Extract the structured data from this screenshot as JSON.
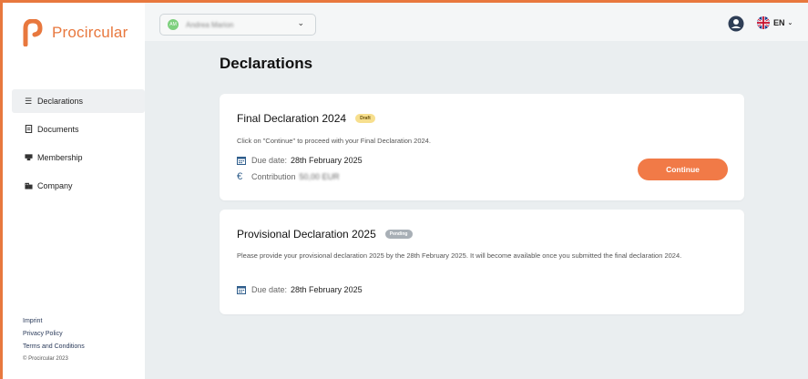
{
  "brand": {
    "name": "Procircular",
    "color": "#e8783e"
  },
  "sidebar": {
    "items": [
      {
        "label": "Declarations",
        "icon": "list-icon",
        "active": true
      },
      {
        "label": "Documents",
        "icon": "document-icon",
        "active": false
      },
      {
        "label": "Membership",
        "icon": "id-card-icon",
        "active": false
      },
      {
        "label": "Company",
        "icon": "building-icon",
        "active": false
      }
    ],
    "footer": {
      "imprint": "Imprint",
      "privacy": "Privacy Policy",
      "terms": "Terms and Conditions",
      "copyright": "© Procircular 2023"
    }
  },
  "topbar": {
    "user": {
      "initials": "AM",
      "name": "Andrea Marion"
    },
    "language": "EN"
  },
  "main": {
    "title": "Declarations",
    "cards": [
      {
        "title": "Final Declaration 2024",
        "badge": "Draft",
        "description": "Click on \"Continue\" to proceed with your Final Declaration 2024.",
        "due_label": "Due date:",
        "due_value": "28th February 2025",
        "contribution_label": "Contribution",
        "contribution_value": "50,00 EUR",
        "button": "Continue"
      },
      {
        "title": "Provisional Declaration 2025",
        "badge": "Pending",
        "description": "Please provide your provisional declaration 2025 by the 28th February 2025. It will become available once you submitted the final declaration 2024.",
        "due_label": "Due date:",
        "due_value": "28th February 2025"
      }
    ]
  },
  "colors": {
    "accent": "#f17a47",
    "draft_badge": "#f7df8e",
    "pending_badge": "#a8afb6",
    "background": "#eaeef0"
  }
}
